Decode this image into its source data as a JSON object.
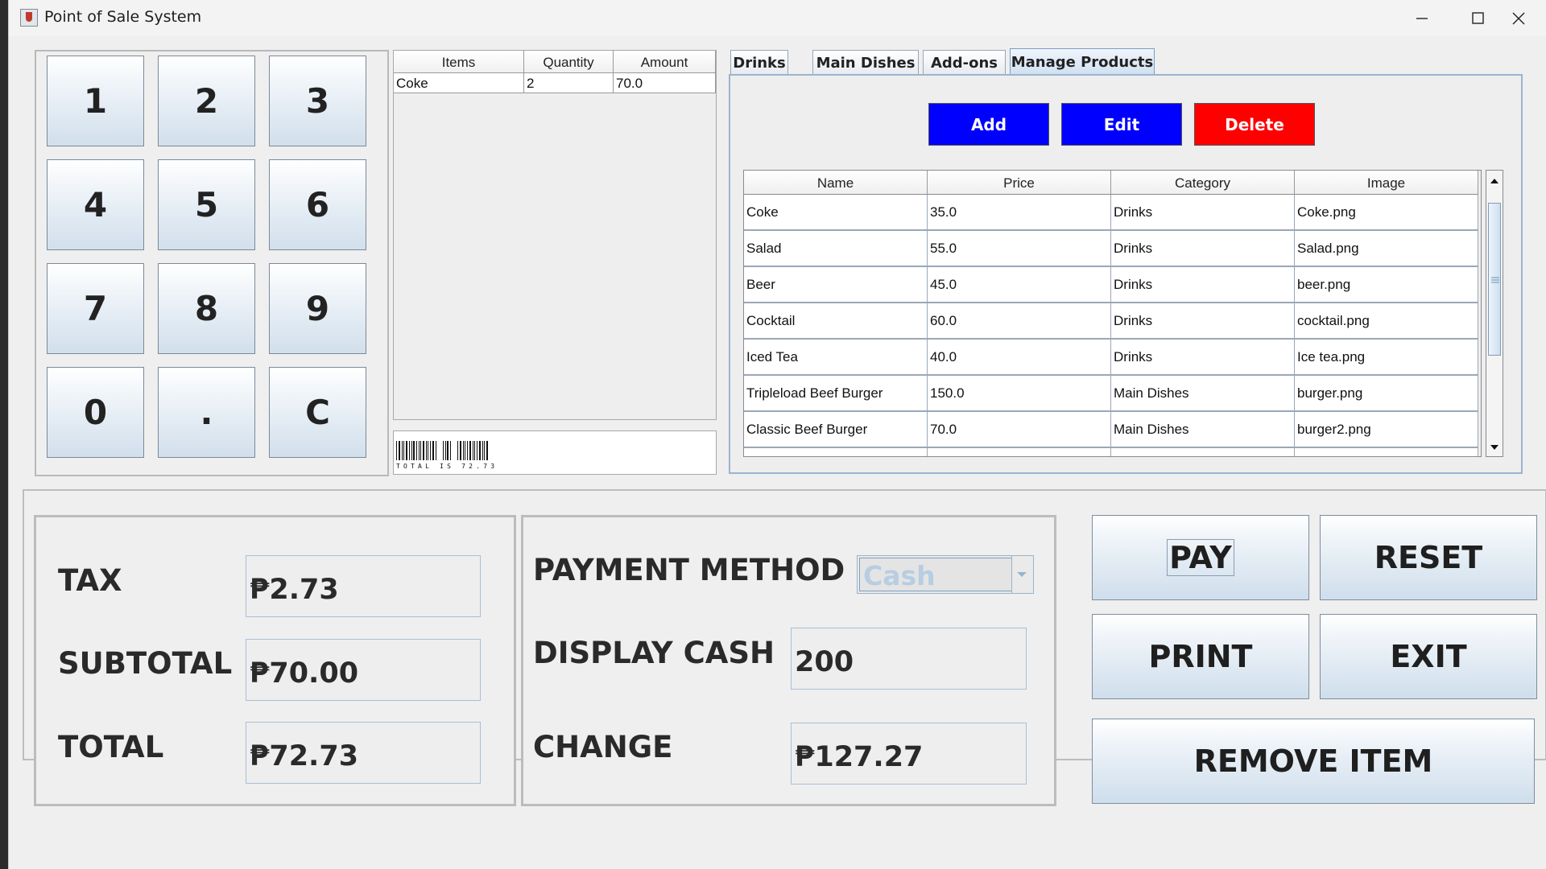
{
  "window": {
    "title": "Point of Sale System"
  },
  "keypad": {
    "keys": [
      "1",
      "2",
      "3",
      "4",
      "5",
      "6",
      "7",
      "8",
      "9",
      "0",
      ".",
      "C"
    ]
  },
  "order": {
    "headers": [
      "Items",
      "Quantity",
      "Amount"
    ],
    "rows": [
      {
        "item": "Coke",
        "quantity": "2",
        "amount": "70.0"
      }
    ],
    "barcode_text": "TOTAL IS 72.73"
  },
  "tabs": [
    "Drinks",
    "Main Dishes",
    "Add-ons",
    "Manage Products"
  ],
  "active_tab": "Manage Products",
  "manage": {
    "add_label": "Add",
    "edit_label": "Edit",
    "delete_label": "Delete",
    "add_color": "#0000ff",
    "edit_color": "#0000ff",
    "delete_color": "#ff0000",
    "headers": [
      "Name",
      "Price",
      "Category",
      "Image"
    ],
    "rows": [
      {
        "name": "Coke",
        "price": "35.0",
        "category": "Drinks",
        "image": "Coke.png"
      },
      {
        "name": "Salad",
        "price": "55.0",
        "category": "Drinks",
        "image": "Salad.png"
      },
      {
        "name": "Beer",
        "price": "45.0",
        "category": "Drinks",
        "image": "beer.png"
      },
      {
        "name": "Cocktail",
        "price": "60.0",
        "category": "Drinks",
        "image": "cocktail.png"
      },
      {
        "name": "Iced Tea",
        "price": "40.0",
        "category": "Drinks",
        "image": "Ice tea.png"
      },
      {
        "name": "Tripleload Beef Burger",
        "price": "150.0",
        "category": "Main Dishes",
        "image": "burger.png"
      },
      {
        "name": "Classic Beef Burger",
        "price": "70.0",
        "category": "Main Dishes",
        "image": "burger2.png"
      }
    ]
  },
  "summary": {
    "tax_label": "TAX",
    "tax_value": "₱2.73",
    "subtotal_label": "SUBTOTAL",
    "subtotal_value": "₱70.00",
    "total_label": "TOTAL",
    "total_value": "₱72.73"
  },
  "payment": {
    "method_label": "PAYMENT METHOD",
    "method_value": "Cash",
    "cash_label": "DISPLAY CASH",
    "cash_value": "200",
    "change_label": "CHANGE",
    "change_value": "₱127.27"
  },
  "actions": {
    "pay": "PAY",
    "reset": "RESET",
    "print": "PRINT",
    "exit": "EXIT",
    "remove": "REMOVE ITEM"
  }
}
